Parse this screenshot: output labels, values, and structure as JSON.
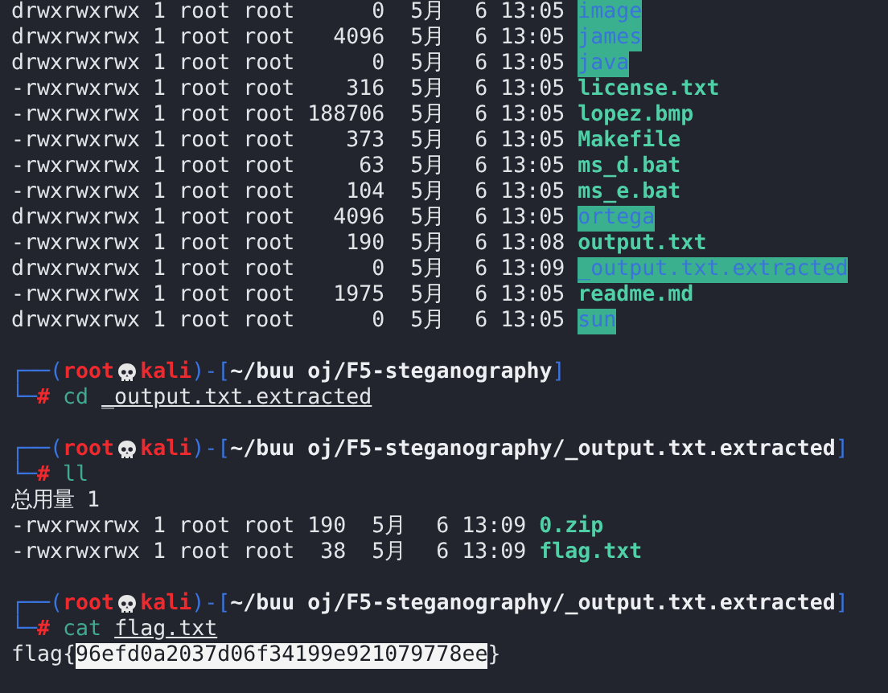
{
  "blocks": [
    {
      "kind": "listing",
      "rows": [
        {
          "permissions": "drwxrwxrwx",
          "links": "1",
          "owner": "root",
          "group": "root",
          "size": "0",
          "month": "5月",
          "day": "6",
          "time": "13:05",
          "name": "image",
          "kind": "directory"
        },
        {
          "permissions": "drwxrwxrwx",
          "links": "1",
          "owner": "root",
          "group": "root",
          "size": "4096",
          "month": "5月",
          "day": "6",
          "time": "13:05",
          "name": "james",
          "kind": "directory"
        },
        {
          "permissions": "drwxrwxrwx",
          "links": "1",
          "owner": "root",
          "group": "root",
          "size": "0",
          "month": "5月",
          "day": "6",
          "time": "13:05",
          "name": "java",
          "kind": "directory"
        },
        {
          "permissions": "-rwxrwxrwx",
          "links": "1",
          "owner": "root",
          "group": "root",
          "size": "316",
          "month": "5月",
          "day": "6",
          "time": "13:05",
          "name": "license.txt",
          "kind": "file"
        },
        {
          "permissions": "-rwxrwxrwx",
          "links": "1",
          "owner": "root",
          "group": "root",
          "size": "188706",
          "month": "5月",
          "day": "6",
          "time": "13:05",
          "name": "lopez.bmp",
          "kind": "file"
        },
        {
          "permissions": "-rwxrwxrwx",
          "links": "1",
          "owner": "root",
          "group": "root",
          "size": "373",
          "month": "5月",
          "day": "6",
          "time": "13:05",
          "name": "Makefile",
          "kind": "file"
        },
        {
          "permissions": "-rwxrwxrwx",
          "links": "1",
          "owner": "root",
          "group": "root",
          "size": "63",
          "month": "5月",
          "day": "6",
          "time": "13:05",
          "name": "ms_d.bat",
          "kind": "file"
        },
        {
          "permissions": "-rwxrwxrwx",
          "links": "1",
          "owner": "root",
          "group": "root",
          "size": "104",
          "month": "5月",
          "day": "6",
          "time": "13:05",
          "name": "ms_e.bat",
          "kind": "file"
        },
        {
          "permissions": "drwxrwxrwx",
          "links": "1",
          "owner": "root",
          "group": "root",
          "size": "4096",
          "month": "5月",
          "day": "6",
          "time": "13:05",
          "name": "ortega",
          "kind": "directory"
        },
        {
          "permissions": "-rwxrwxrwx",
          "links": "1",
          "owner": "root",
          "group": "root",
          "size": "190",
          "month": "5月",
          "day": "6",
          "time": "13:08",
          "name": "output.txt",
          "kind": "file"
        },
        {
          "permissions": "drwxrwxrwx",
          "links": "1",
          "owner": "root",
          "group": "root",
          "size": "0",
          "month": "5月",
          "day": "6",
          "time": "13:09",
          "name": "_output.txt.extracted",
          "kind": "directory"
        },
        {
          "permissions": "-rwxrwxrwx",
          "links": "1",
          "owner": "root",
          "group": "root",
          "size": "1975",
          "month": "5月",
          "day": "6",
          "time": "13:05",
          "name": "readme.md",
          "kind": "file"
        },
        {
          "permissions": "drwxrwxrwx",
          "links": "1",
          "owner": "root",
          "group": "root",
          "size": "0",
          "month": "5月",
          "day": "6",
          "time": "13:05",
          "name": "sun",
          "kind": "directory"
        }
      ]
    },
    {
      "kind": "prompt",
      "corner_top": "┌──(",
      "user": "root",
      "host": "kali",
      "open": ")-[",
      "path": "~/buu oj/F5-steganography",
      "close": "]",
      "corner_bottom": "└─",
      "sign": "#",
      "command": "cd",
      "argument": "_output.txt.extracted"
    },
    {
      "kind": "prompt",
      "corner_top": "┌──(",
      "user": "root",
      "host": "kali",
      "open": ")-[",
      "path": "~/buu oj/F5-steganography/_output.txt.extracted",
      "close": "]",
      "corner_bottom": "└─",
      "sign": "#",
      "command": "ll"
    },
    {
      "kind": "text",
      "text": "总用量 1"
    },
    {
      "kind": "listing",
      "rows": [
        {
          "permissions": "-rwxrwxrwx",
          "links": "1",
          "owner": "root",
          "group": "root",
          "size": "190",
          "month": "5月",
          "day": "6",
          "time": "13:09",
          "name": "0.zip",
          "kind": "file"
        },
        {
          "permissions": "-rwxrwxrwx",
          "links": "1",
          "owner": "root",
          "group": "root",
          "size": "38",
          "month": "5月",
          "day": "6",
          "time": "13:09",
          "name": "flag.txt",
          "kind": "file"
        }
      ]
    },
    {
      "kind": "prompt",
      "corner_top": "┌──(",
      "user": "root",
      "host": "kali",
      "open": ")-[",
      "path": "~/buu oj/F5-steganography/_output.txt.extracted",
      "close": "]",
      "corner_bottom": "└─",
      "sign": "#",
      "command": "cat",
      "argument": "flag.txt"
    },
    {
      "kind": "flag",
      "prefix": "flag{",
      "value": "96efd0a2037d06f34199e921079778ee",
      "suffix": "}",
      "selected": true
    }
  ]
}
